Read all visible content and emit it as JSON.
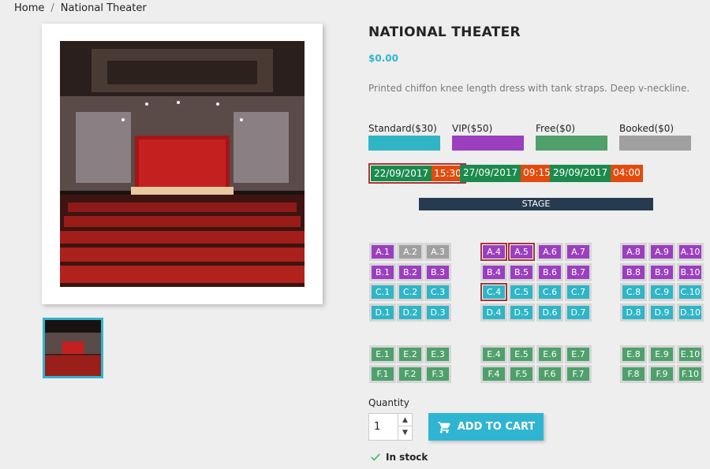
{
  "breadcrumb": {
    "home": "Home",
    "current": "National Theater"
  },
  "product": {
    "title": "NATIONAL THEATER",
    "price": "$0.00",
    "description": "Printed chiffon knee length dress with tank straps. Deep v-neckline."
  },
  "legend": [
    {
      "label": "Standard($30)",
      "color": "#2fb5c5"
    },
    {
      "label": "VIP($50)",
      "color": "#9b3fbf"
    },
    {
      "label": "Free($0)",
      "color": "#4fa06b"
    },
    {
      "label": "Booked($0)",
      "color": "#a0a0a0"
    }
  ],
  "dates": [
    {
      "date": "22/09/2017",
      "time": "15:30",
      "selected": true
    },
    {
      "date": "27/09/2017",
      "time": "09:15",
      "selected": false
    },
    {
      "date": "29/09/2017",
      "time": "04:00",
      "selected": false
    }
  ],
  "stage_label": "STAGE",
  "seats": [
    {
      "label": "A.1",
      "type": "vip"
    },
    {
      "label": "A.2",
      "type": "booked"
    },
    {
      "label": "A.3",
      "type": "booked"
    },
    {
      "label": "A.4",
      "type": "vip",
      "selected": true
    },
    {
      "label": "A.5",
      "type": "vip",
      "selected": true
    },
    {
      "label": "A.6",
      "type": "vip"
    },
    {
      "label": "A.7",
      "type": "vip"
    },
    {
      "label": "A.8",
      "type": "vip"
    },
    {
      "label": "A.9",
      "type": "vip"
    },
    {
      "label": "A.10",
      "type": "vip"
    },
    {
      "label": "B.1",
      "type": "vip"
    },
    {
      "label": "B.2",
      "type": "vip"
    },
    {
      "label": "B.3",
      "type": "vip"
    },
    {
      "label": "B.4",
      "type": "vip"
    },
    {
      "label": "B.5",
      "type": "vip"
    },
    {
      "label": "B.6",
      "type": "vip"
    },
    {
      "label": "B.7",
      "type": "vip"
    },
    {
      "label": "B.8",
      "type": "vip"
    },
    {
      "label": "B.9",
      "type": "vip"
    },
    {
      "label": "B.10",
      "type": "vip"
    },
    {
      "label": "C.1",
      "type": "standard"
    },
    {
      "label": "C.2",
      "type": "standard"
    },
    {
      "label": "C.3",
      "type": "standard"
    },
    {
      "label": "C.4",
      "type": "standard",
      "selected": true
    },
    {
      "label": "C.5",
      "type": "standard"
    },
    {
      "label": "C.6",
      "type": "standard"
    },
    {
      "label": "C.7",
      "type": "standard"
    },
    {
      "label": "C.8",
      "type": "standard"
    },
    {
      "label": "C.9",
      "type": "standard"
    },
    {
      "label": "C.10",
      "type": "standard"
    },
    {
      "label": "D.1",
      "type": "standard"
    },
    {
      "label": "D.2",
      "type": "standard"
    },
    {
      "label": "D.3",
      "type": "standard"
    },
    {
      "label": "D.4",
      "type": "standard"
    },
    {
      "label": "D.5",
      "type": "standard"
    },
    {
      "label": "D.6",
      "type": "standard"
    },
    {
      "label": "D.7",
      "type": "standard"
    },
    {
      "label": "D.8",
      "type": "standard"
    },
    {
      "label": "D.9",
      "type": "standard"
    },
    {
      "label": "D.10",
      "type": "standard"
    },
    {
      "label": "E.1",
      "type": "free"
    },
    {
      "label": "E.2",
      "type": "free"
    },
    {
      "label": "E.3",
      "type": "free"
    },
    {
      "label": "E.4",
      "type": "free"
    },
    {
      "label": "E.5",
      "type": "free"
    },
    {
      "label": "E.6",
      "type": "free"
    },
    {
      "label": "E.7",
      "type": "free"
    },
    {
      "label": "E.8",
      "type": "free"
    },
    {
      "label": "E.9",
      "type": "free"
    },
    {
      "label": "E.10",
      "type": "free"
    },
    {
      "label": "F.1",
      "type": "free"
    },
    {
      "label": "F.2",
      "type": "free"
    },
    {
      "label": "F.3",
      "type": "free"
    },
    {
      "label": "F.4",
      "type": "free"
    },
    {
      "label": "F.5",
      "type": "free"
    },
    {
      "label": "F.6",
      "type": "free"
    },
    {
      "label": "F.7",
      "type": "free"
    },
    {
      "label": "F.8",
      "type": "free"
    },
    {
      "label": "F.9",
      "type": "free"
    },
    {
      "label": "F.10",
      "type": "free"
    }
  ],
  "quantity": {
    "label": "Quantity",
    "value": "1"
  },
  "add_to_cart": "ADD TO CART",
  "stock": "In stock",
  "colors": {
    "accent": "#2fb5d2",
    "stage": "#263b4f",
    "date": "#1b8a4d",
    "time": "#e24b0e",
    "selected_border": "#aa3333"
  }
}
